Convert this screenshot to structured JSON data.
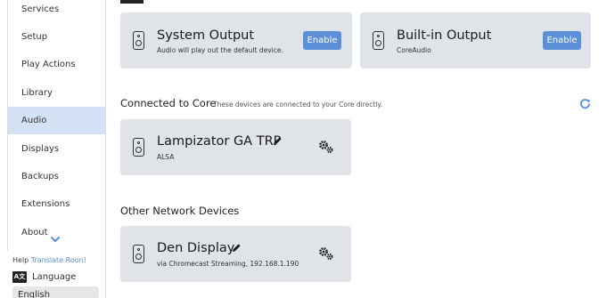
{
  "sidebar": {
    "items": [
      {
        "label": "Services"
      },
      {
        "label": "Setup"
      },
      {
        "label": "Play Actions"
      },
      {
        "label": "Library"
      },
      {
        "label": "Audio"
      },
      {
        "label": "Displays"
      },
      {
        "label": "Backups"
      },
      {
        "label": "Extensions"
      },
      {
        "label": "About"
      }
    ],
    "active_item": "Audio",
    "help_prefix": "Help ",
    "help_link": "Translate Roon!",
    "language_icon_text": "A文",
    "language_label": "Language",
    "language_value": "English"
  },
  "zones": {
    "system_output": {
      "title": "System Output",
      "subtitle": "Audio will play out the default device.",
      "button": "Enable"
    },
    "builtin_output": {
      "title": "Built-in Output",
      "subtitle": "CoreAudio",
      "button": "Enable"
    }
  },
  "connected": {
    "title": "Connected to Core",
    "description": "These devices are connected to your Core directly.",
    "device": {
      "title": "Lampizator GA TRP",
      "subtitle": "ALSA"
    }
  },
  "network": {
    "title": "Other Network Devices",
    "device": {
      "title": "Den Display",
      "subtitle": "via Chromecast Streaming, 192.168.1.190"
    }
  },
  "colors": {
    "accent": "#5b8fd8",
    "active_bg": "#d3e1f4",
    "card_bg": "#e0e3e8"
  }
}
